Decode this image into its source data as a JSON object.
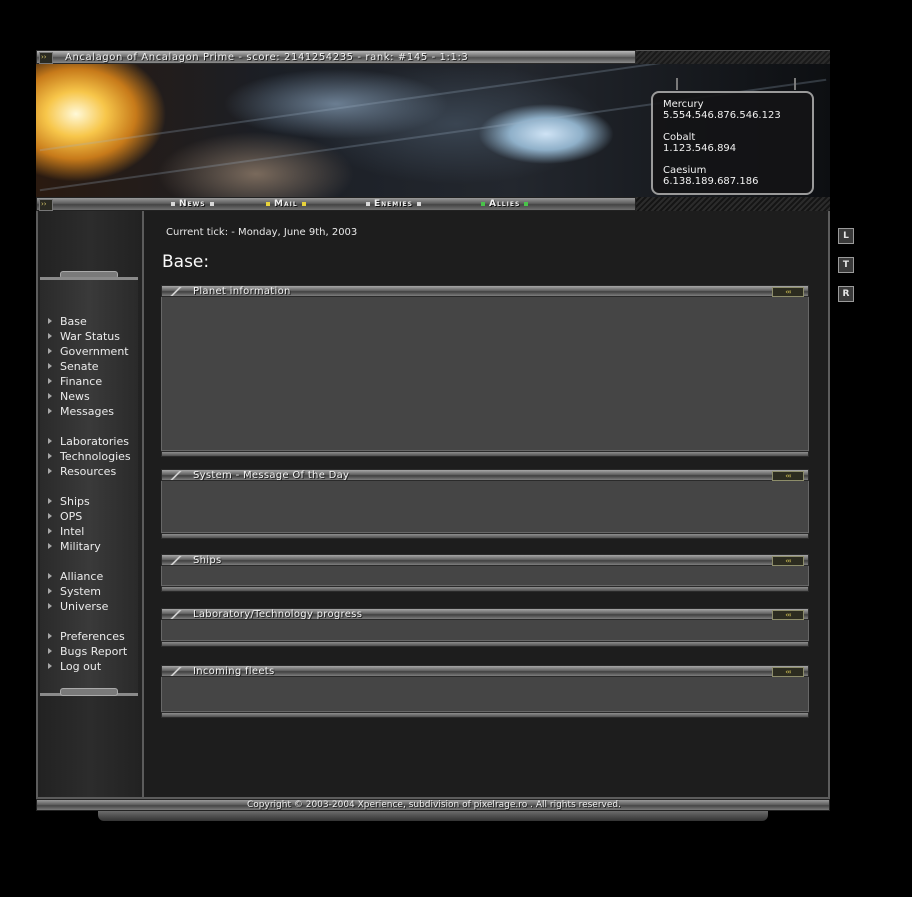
{
  "window": {
    "title": "Ancalagon of Ancalagon Prime - score: 2141254235 - rank: #145 - 1:1:3"
  },
  "resources": [
    {
      "name": "Mercury",
      "value": "5.554.546.876.546.123"
    },
    {
      "name": "Cobalt",
      "value": "1.123.546.894"
    },
    {
      "name": "Caesium",
      "value": "6.138.189.687.186"
    }
  ],
  "nav": [
    {
      "label": "News",
      "dot_color": "#d8d8d8"
    },
    {
      "label": "Mail",
      "dot_color": "#e8d23a"
    },
    {
      "label": "Enemies",
      "dot_color": "#d8d8d8"
    },
    {
      "label": "Allies",
      "dot_color": "#49c24a"
    }
  ],
  "menu": {
    "groups": [
      [
        "Base",
        "War Status",
        "Government",
        "Senate",
        "Finance",
        "News",
        "Messages"
      ],
      [
        "Laboratories",
        "Technologies",
        "Resources"
      ],
      [
        "Ships",
        "OPS",
        "Intel",
        "Military"
      ],
      [
        "Alliance",
        "System",
        "Universe"
      ],
      [
        "Preferences",
        "Bugs Report",
        "Log out"
      ]
    ]
  },
  "main": {
    "tick": "Current tick: - Monday, June 9th, 2003",
    "page_title": "Base:",
    "toggle_label": "‹‹‹",
    "boxes": [
      {
        "label": "Planet information"
      },
      {
        "label": "System - Message Of the Day"
      },
      {
        "label": "Ships"
      },
      {
        "label": "Laboratory/Technology progress"
      },
      {
        "label": "Incoming fleets"
      }
    ]
  },
  "side_buttons": [
    "L",
    "T",
    "R"
  ],
  "footer": {
    "text": "Copyright © 2003-2004 Xperience, subdivision of pixelrage.ro . All rights reserved."
  },
  "colors": {
    "background": "#000000",
    "panel": "#1d1d1d",
    "box_body": "#454545",
    "accent_yellow": "#e0cf58",
    "allies_green": "#49c24a"
  }
}
